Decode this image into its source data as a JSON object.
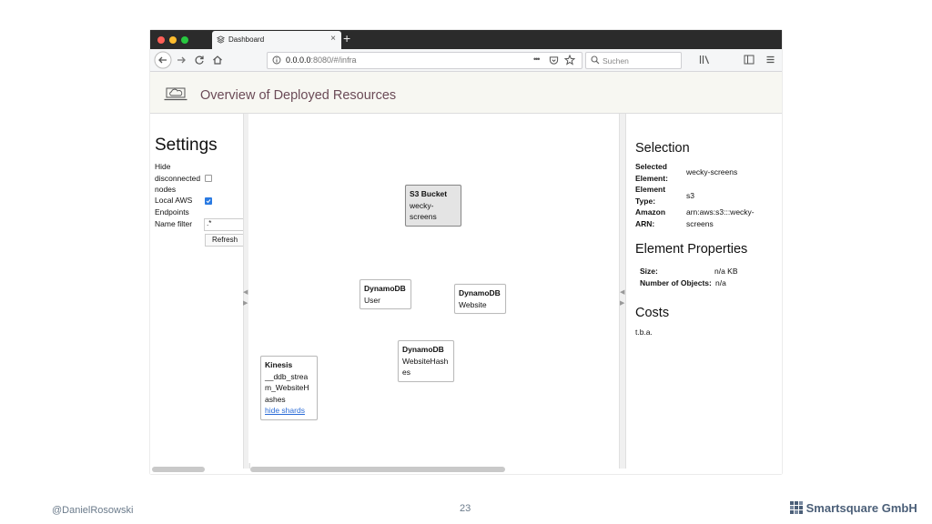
{
  "browser": {
    "tab_title": "Dashboard",
    "tab_close": "×",
    "new_tab": "+",
    "url_host": "0.0.0.0",
    "url_path": ":8080/#/infra",
    "search_placeholder": "Suchen"
  },
  "page": {
    "title": "Overview of Deployed Resources"
  },
  "settings": {
    "heading": "Settings",
    "hide_disconnected_label": "Hide disconnected nodes",
    "hide_disconnected_line1": "Hide",
    "hide_disconnected_line2": "disconnected",
    "hide_disconnected_line3": "nodes",
    "hide_disconnected_checked": false,
    "local_aws_line1": "Local AWS",
    "local_aws_line2": "Endpoints",
    "local_aws_checked": true,
    "name_filter_label": "Name filter",
    "name_filter_value": ".*",
    "refresh_label": "Refresh "
  },
  "canvas": {
    "nodes": [
      {
        "title": "S3 Bucket",
        "lines": [
          "wecky-",
          "screens"
        ],
        "selected": true
      },
      {
        "title": "DynamoDB",
        "lines": [
          "User"
        ]
      },
      {
        "title": "DynamoDB",
        "lines": [
          "Website"
        ]
      },
      {
        "title": "DynamoDB",
        "lines": [
          "WebsiteHash",
          "es"
        ]
      },
      {
        "title": "Kinesis",
        "lines": [
          "__ddb_strea",
          "m_WebsiteH",
          "ashes"
        ],
        "link": "hide shards"
      }
    ]
  },
  "selection": {
    "heading": "Selection",
    "rows": [
      {
        "label1": "Selected",
        "label2": "Element:",
        "value1": "wecky-screens",
        "value2": ""
      },
      {
        "label1": "Element",
        "label2": "Type:",
        "value1": "s3",
        "value2": ""
      },
      {
        "label1": "Amazon",
        "label2": "ARN:",
        "value1": "arn:aws:s3:::wecky-",
        "value2": "screens"
      }
    ]
  },
  "element_properties": {
    "heading": "Element Properties",
    "size_label": "Size:",
    "size_value": "n/a KB",
    "objects_label": "Number of Objects:",
    "objects_value": "n/a"
  },
  "costs": {
    "heading": "Costs",
    "value": "t.b.a."
  },
  "slide": {
    "author": "@DanielRosowski",
    "page_number": "23",
    "company": "Smartsquare GmbH"
  },
  "colors": {
    "close": "#ff5f57",
    "minimize": "#febc2e",
    "maximize": "#28c840",
    "accent": "#2a7ae2",
    "title": "#6b4b57"
  }
}
